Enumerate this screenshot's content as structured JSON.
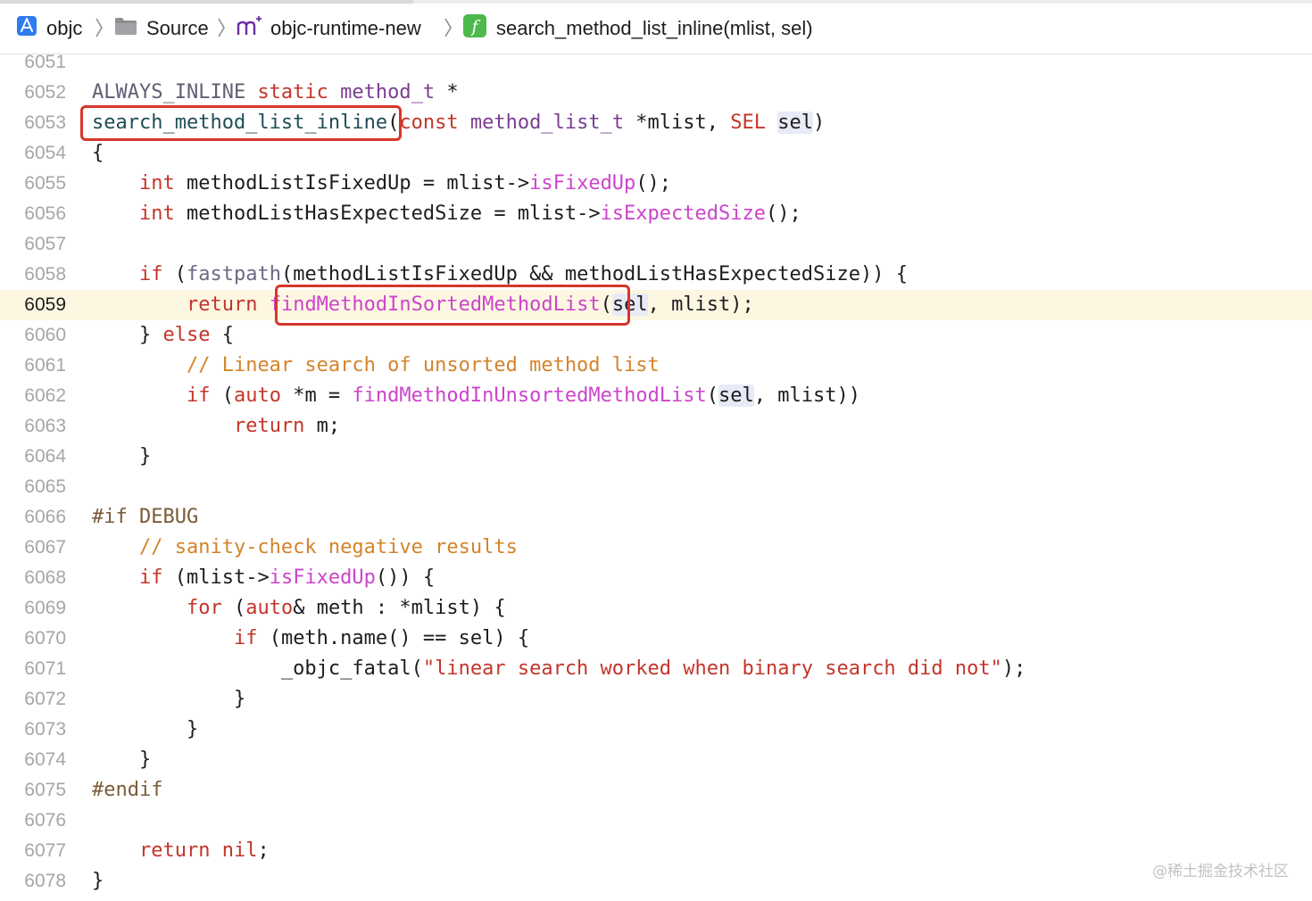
{
  "breadcrumb": {
    "items": [
      {
        "label": "objc",
        "icon": "xcode-project-icon"
      },
      {
        "label": "Source",
        "icon": "folder-icon"
      },
      {
        "label": "objc-runtime-new",
        "icon": "objc-source-file-icon"
      },
      {
        "label": "search_method_list_inline(mlist, sel)",
        "icon": "function-icon"
      }
    ]
  },
  "editor": {
    "current_line": "6059",
    "line_numbers": [
      "6051",
      "6052",
      "6053",
      "6054",
      "6055",
      "6056",
      "6057",
      "6058",
      "6059",
      "6060",
      "6061",
      "6062",
      "6063",
      "6064",
      "6065",
      "6066",
      "6067",
      "6068",
      "6069",
      "6070",
      "6071",
      "6072",
      "6073",
      "6074",
      "6075",
      "6076",
      "6077",
      "6078"
    ],
    "highlighted_identifiers": [
      "search_method_list_inline",
      "findMethodInSortedMethodList"
    ],
    "code_lines": [
      "",
      "ALWAYS_INLINE static method_t *",
      "search_method_list_inline(const method_list_t *mlist, SEL sel)",
      "{",
      "    int methodListIsFixedUp = mlist->isFixedUp();",
      "    int methodListHasExpectedSize = mlist->isExpectedSize();",
      "",
      "    if (fastpath(methodListIsFixedUp && methodListHasExpectedSize)) {",
      "        return findMethodInSortedMethodList(sel, mlist);",
      "    } else {",
      "        // Linear search of unsorted method list",
      "        if (auto *m = findMethodInUnsortedMethodList(sel, mlist))",
      "            return m;",
      "    }",
      "",
      "#if DEBUG",
      "    // sanity-check negative results",
      "    if (mlist->isFixedUp()) {",
      "        for (auto& meth : *mlist) {",
      "            if (meth.name() == sel) {",
      "                _objc_fatal(\"linear search worked when binary search did not\");",
      "            }",
      "        }",
      "    }",
      "#endif",
      "",
      "    return nil;",
      "}"
    ]
  },
  "watermark": "@稀土掘金技术社区",
  "colors": {
    "keyword": "#c4352a",
    "type": "#7b3d8f",
    "method_call": "#cc44cc",
    "comment": "#d4832a",
    "preprocessor": "#7a5a37",
    "current_line_bg": "#fdf7e2",
    "annotation_box": "#d8352a"
  }
}
